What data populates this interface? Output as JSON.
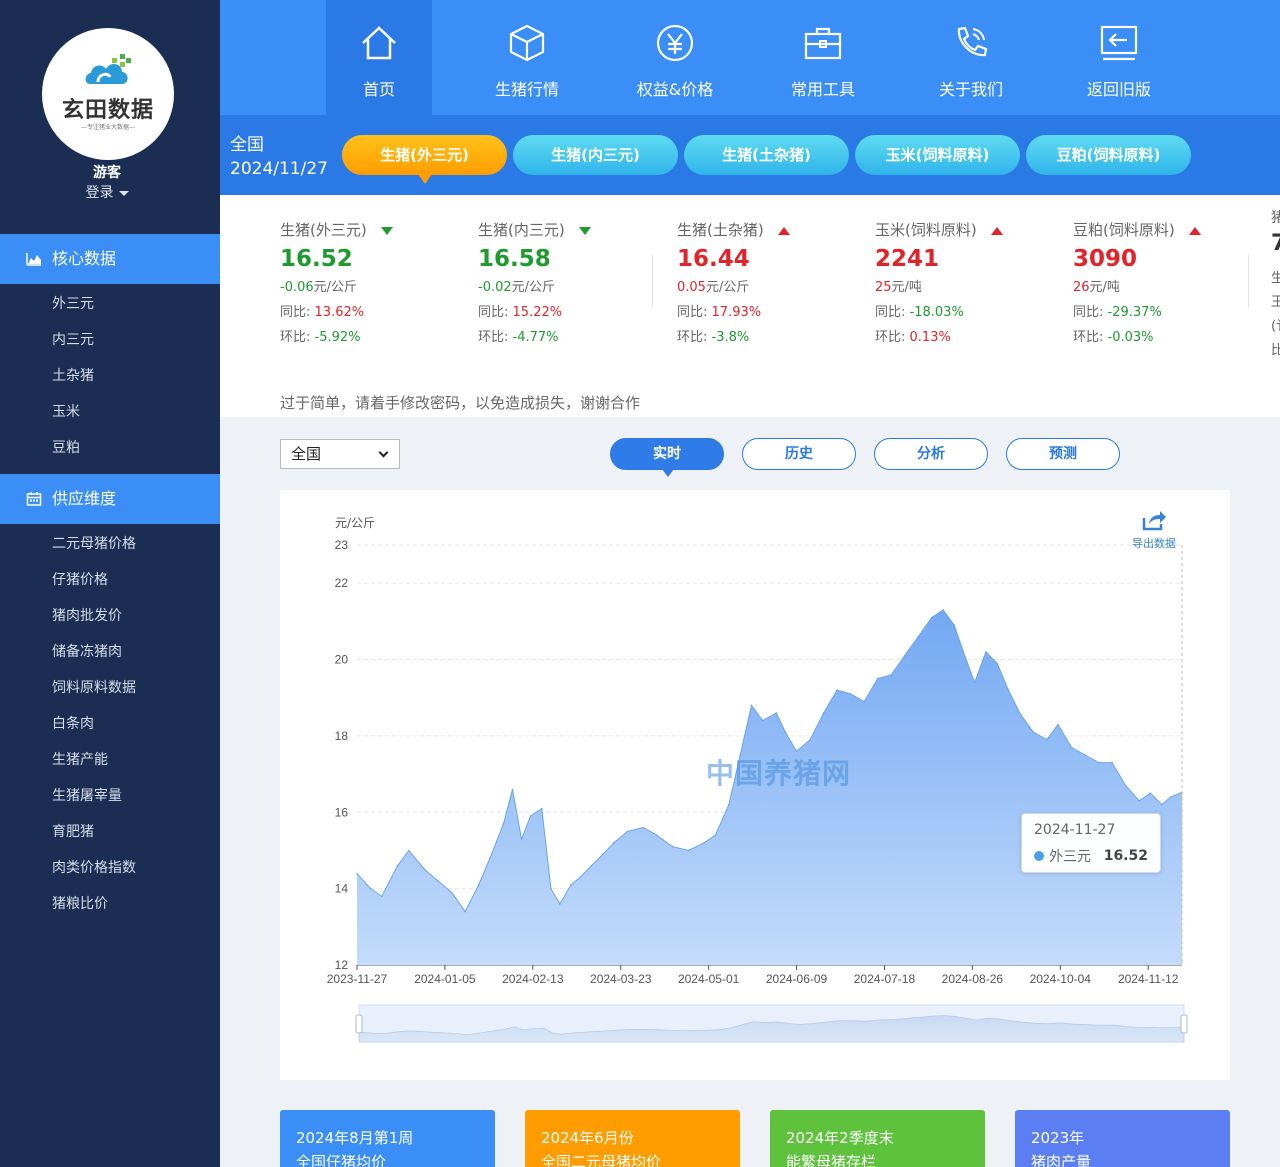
{
  "sidebar": {
    "logo_text": "玄田数据",
    "logo_sub": "—专注猪业大数据—",
    "user_name": "游客",
    "login_label": "登录",
    "section1": {
      "title": "核心数据",
      "icon": "chart-area-icon",
      "items": [
        "外三元",
        "内三元",
        "土杂猪",
        "玉米",
        "豆粕"
      ]
    },
    "section2": {
      "title": "供应维度",
      "icon": "calendar-icon",
      "items": [
        "二元母猪价格",
        "仔猪价格",
        "猪肉批发价",
        "储备冻猪肉",
        "饲料原料数据",
        "白条肉",
        "生猪产能",
        "生猪屠宰量",
        "育肥猪",
        "肉类价格指数",
        "猪粮比价"
      ]
    }
  },
  "topnav": {
    "items": [
      {
        "label": "首页",
        "icon": "home-icon",
        "active": true
      },
      {
        "label": "生猪行情",
        "icon": "cube-icon",
        "active": false
      },
      {
        "label": "权益&价格",
        "icon": "yen-icon",
        "active": false
      },
      {
        "label": "常用工具",
        "icon": "toolbox-icon",
        "active": false
      },
      {
        "label": "关于我们",
        "icon": "phone-icon",
        "active": false
      },
      {
        "label": "返回旧版",
        "icon": "return-icon",
        "active": false
      }
    ]
  },
  "subbar": {
    "region": "全国",
    "date": "2024/11/27",
    "pills": [
      "生猪(外三元)",
      "生猪(内三元)",
      "生猪(土杂猪)",
      "玉米(饲料原料)",
      "豆粕(饲料原料)"
    ],
    "active_pill": 0
  },
  "summary": {
    "cards": [
      {
        "name": "生猪(外三元)",
        "trend": "down",
        "value": "16.52",
        "change": "-0.06",
        "unit": "元/公斤",
        "yoy_label": "同比:",
        "yoy": "13.62%",
        "yoy_dir": "up",
        "mom_label": "环比:",
        "mom": "-5.92%",
        "mom_dir": "down"
      },
      {
        "name": "生猪(内三元)",
        "trend": "down",
        "value": "16.58",
        "change": "-0.02",
        "unit": "元/公斤",
        "yoy_label": "同比:",
        "yoy": "15.22%",
        "yoy_dir": "up",
        "mom_label": "环比:",
        "mom": "-4.77%",
        "mom_dir": "down"
      },
      {
        "name": "生猪(土杂猪)",
        "trend": "up",
        "value": "16.44",
        "change": "0.05",
        "unit": "元/公斤",
        "yoy_label": "同比:",
        "yoy": "17.93%",
        "yoy_dir": "up",
        "mom_label": "环比:",
        "mom": "-3.8%",
        "mom_dir": "down"
      },
      {
        "name": "玉米(饲料原料)",
        "trend": "up",
        "value": "2241",
        "change": "25",
        "unit": "元/吨",
        "yoy_label": "同比:",
        "yoy": "-18.03%",
        "yoy_dir": "down",
        "mom_label": "环比:",
        "mom": "0.13%",
        "mom_dir": "up"
      },
      {
        "name": "豆粕(饲料原料)",
        "trend": "up",
        "value": "3090",
        "change": "26",
        "unit": "元/吨",
        "yoy_label": "同比:",
        "yoy": "-29.37%",
        "yoy_dir": "down",
        "mom_label": "环比:",
        "mom": "-0.03%",
        "mom_dir": "down"
      }
    ],
    "edge_fragments": [
      "猪",
      "7",
      "生",
      "王",
      "(讠",
      "比"
    ],
    "notice": "过于简单，请着手修改密码，以免造成损失，谢谢合作"
  },
  "controls": {
    "region_select": "全国",
    "tabs": [
      "实时",
      "历史",
      "分析",
      "预测"
    ],
    "active_tab": 0
  },
  "chart_meta": {
    "export_label": "导出数据",
    "export_icon": "share-icon",
    "watermark": "中国养猪网",
    "tooltip_date": "2024-11-27",
    "tooltip_series": "外三元",
    "tooltip_value": "16.52"
  },
  "chart_data": {
    "type": "area",
    "title": "",
    "ylabel": "元/公斤",
    "xlabel": "",
    "ylim": [
      12,
      23
    ],
    "yticks": [
      12,
      14,
      16,
      18,
      20,
      22,
      23
    ],
    "x_start": "2023-11-27",
    "x_end": "2024-11-27",
    "xticks": [
      "2023-11-27",
      "2024-01-05",
      "2024-02-13",
      "2024-03-23",
      "2024-05-01",
      "2024-06-09",
      "2024-07-18",
      "2024-08-26",
      "2024-10-04",
      "2024-11-12"
    ],
    "grid": true,
    "color": "#7fb0f4",
    "series": [
      {
        "name": "外三元",
        "x": [
          "2023-11-27",
          "2023-12-03",
          "2023-12-08",
          "2023-12-15",
          "2023-12-20",
          "2023-12-27",
          "2024-01-02",
          "2024-01-08",
          "2024-01-14",
          "2024-01-20",
          "2024-01-25",
          "2024-01-31",
          "2024-02-04",
          "2024-02-08",
          "2024-02-12",
          "2024-02-17",
          "2024-02-21",
          "2024-02-25",
          "2024-03-01",
          "2024-03-05",
          "2024-03-10",
          "2024-03-15",
          "2024-03-20",
          "2024-03-26",
          "2024-04-02",
          "2024-04-08",
          "2024-04-15",
          "2024-04-22",
          "2024-04-29",
          "2024-05-04",
          "2024-05-10",
          "2024-05-15",
          "2024-05-20",
          "2024-05-25",
          "2024-05-31",
          "2024-06-04",
          "2024-06-09",
          "2024-06-15",
          "2024-06-21",
          "2024-06-27",
          "2024-07-03",
          "2024-07-09",
          "2024-07-15",
          "2024-07-21",
          "2024-07-27",
          "2024-08-02",
          "2024-08-08",
          "2024-08-13",
          "2024-08-18",
          "2024-08-22",
          "2024-08-27",
          "2024-09-01",
          "2024-09-06",
          "2024-09-11",
          "2024-09-16",
          "2024-09-22",
          "2024-09-28",
          "2024-10-03",
          "2024-10-09",
          "2024-10-15",
          "2024-10-21",
          "2024-10-27",
          "2024-11-02",
          "2024-11-08",
          "2024-11-13",
          "2024-11-18",
          "2024-11-22",
          "2024-11-27"
        ],
        "values": [
          14.4,
          14.0,
          13.8,
          14.6,
          15.0,
          14.5,
          14.2,
          13.9,
          13.4,
          14.1,
          14.8,
          15.7,
          16.6,
          15.3,
          15.9,
          16.1,
          14.0,
          13.6,
          14.1,
          14.3,
          14.6,
          14.9,
          15.2,
          15.5,
          15.6,
          15.4,
          15.1,
          15.0,
          15.2,
          15.4,
          16.2,
          17.5,
          18.8,
          18.4,
          18.6,
          18.1,
          17.6,
          17.9,
          18.6,
          19.2,
          19.1,
          18.9,
          19.5,
          19.6,
          20.1,
          20.6,
          21.1,
          21.3,
          20.9,
          20.2,
          19.4,
          20.2,
          19.9,
          19.2,
          18.6,
          18.1,
          17.9,
          18.3,
          17.7,
          17.5,
          17.3,
          17.3,
          16.7,
          16.3,
          16.5,
          16.2,
          16.4,
          16.52
        ]
      }
    ]
  }
}
